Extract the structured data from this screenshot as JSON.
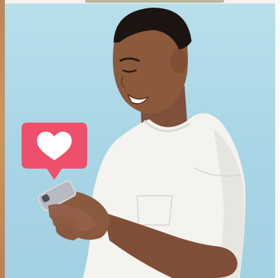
{
  "image": {
    "subject": "man-smiling-at-phone",
    "icons": {
      "like": "heart-icon",
      "device": "smartphone-icon"
    }
  },
  "colors": {
    "background": "#a9d6e6",
    "shirt": "#f4f3ef",
    "skin": "#8b5a3c",
    "hair": "#1c1410",
    "like_badge": "#ee4f6a",
    "heart": "#ffffff",
    "phone": "#d6d7db"
  }
}
